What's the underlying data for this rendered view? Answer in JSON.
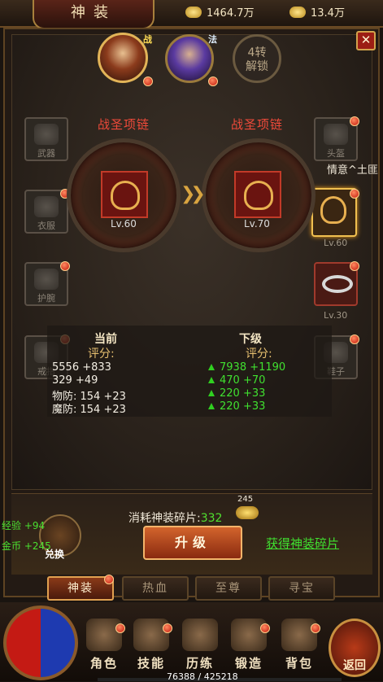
{
  "header": {
    "title": "神装",
    "gold": "1464.7万",
    "ingot": "13.4万"
  },
  "characters": [
    {
      "badge": "战",
      "name": "character-warrior"
    },
    {
      "badge": "法",
      "name": "character-mage"
    }
  ],
  "lock": {
    "line1": "4转",
    "line2": "解锁"
  },
  "left_slots": [
    {
      "label": "武器"
    },
    {
      "label": "衣服"
    },
    {
      "label": "护腕"
    },
    {
      "label": "戒指"
    }
  ],
  "right_slots": [
    {
      "label": "头盔"
    },
    {
      "label": "",
      "level": "Lv.60"
    },
    {
      "label": "",
      "level": "Lv.30"
    },
    {
      "label": "鞋子"
    }
  ],
  "side_tip": "情意^土匪",
  "current_item": {
    "name": "战圣项链",
    "level": "Lv.60"
  },
  "next_item": {
    "name": "战圣项链",
    "level": "Lv.70"
  },
  "stats": {
    "current_header": "当前",
    "next_header": "下级",
    "score_label": "评分:",
    "current": [
      "5556 +833",
      "329 +49",
      "物防: 154 +23",
      "魔防: 154 +23"
    ],
    "next": [
      "7938 +1190",
      "470 +70",
      "220 +33",
      "220 +33"
    ]
  },
  "cost": {
    "label": "消耗神装碎片:",
    "value": "332",
    "owned": "245"
  },
  "upgrade_button": "升级",
  "get_fragments_link": "获得神装碎片",
  "exchange_label": "兑换",
  "floating": {
    "exp": "经验 +94",
    "gold": "金币 +245"
  },
  "tabs": [
    "神装",
    "热血",
    "至尊",
    "寻宝"
  ],
  "nav": [
    "角色",
    "技能",
    "历练",
    "锻造",
    "背包"
  ],
  "return_label": "返回",
  "exp_text": "76388 / 425218"
}
